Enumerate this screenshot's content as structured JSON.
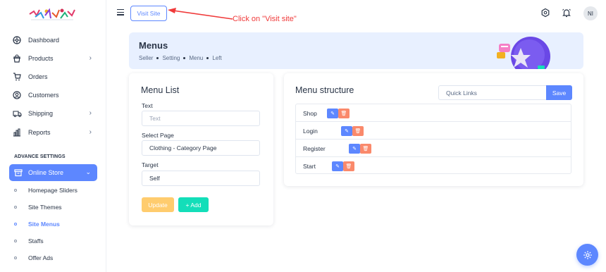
{
  "sidebar": {
    "items": [
      {
        "label": "Dashboard",
        "icon": "dashboard-icon",
        "has_submenu": false
      },
      {
        "label": "Products",
        "icon": "shopping-bag-icon",
        "has_submenu": true
      },
      {
        "label": "Orders",
        "icon": "cart-icon",
        "has_submenu": false
      },
      {
        "label": "Customers",
        "icon": "user-circle-icon",
        "has_submenu": false
      },
      {
        "label": "Shipping",
        "icon": "truck-icon",
        "has_submenu": true
      },
      {
        "label": "Reports",
        "icon": "bar-chart-icon",
        "has_submenu": true
      }
    ],
    "section_title": "ADVANCE SETTINGS",
    "active_item": {
      "label": "Online Store",
      "icon": "store-icon"
    },
    "sub_items": [
      {
        "label": "Homepage Sliders",
        "active": false
      },
      {
        "label": "Site Themes",
        "active": false
      },
      {
        "label": "Site Menus",
        "active": true
      },
      {
        "label": "Staffs",
        "active": false
      },
      {
        "label": "Offer Ads",
        "active": false
      }
    ]
  },
  "topbar": {
    "visit_site_label": "Visit Site",
    "annotation": "Click on \"Visit site\"",
    "avatar_initials": "NI"
  },
  "banner": {
    "title": "Menus",
    "breadcrumb": [
      "Seller",
      "Setting",
      "Menu",
      "Left"
    ]
  },
  "menu_list_card": {
    "title": "Menu List",
    "text_label": "Text",
    "text_placeholder": "Text",
    "select_page_label": "Select Page",
    "select_page_value": "Clothing - Category Page",
    "target_label": "Target",
    "target_value": "Self",
    "update_label": "Update",
    "add_label": "+ Add"
  },
  "menu_structure_card": {
    "title": "Menu structure",
    "quick_links_placeholder": "Quick Links",
    "save_label": "Save",
    "items": [
      "Shop",
      "Login",
      "Register",
      "Start"
    ]
  },
  "colors": {
    "primary": "#5d87ff",
    "warning": "#ffc75f",
    "success": "#13deb9",
    "danger": "#fa896b",
    "annotation": "#f03a3a",
    "banner_bg": "#e8f0ff"
  }
}
